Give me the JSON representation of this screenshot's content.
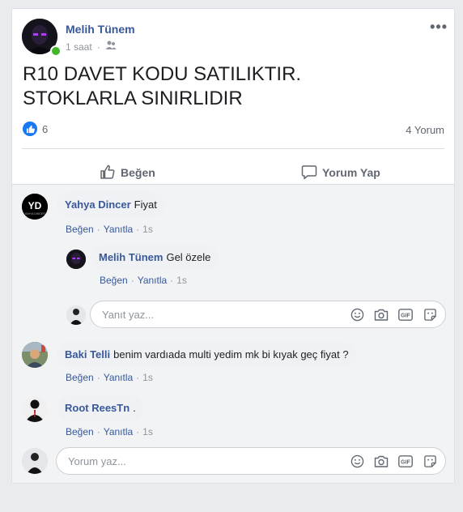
{
  "post": {
    "author": "Melih Tünem",
    "time": "1 saat",
    "text_line1": "R10 DAVET KODU SATILIKTIR.",
    "text_line2": "STOKLARLA SINIRLIDIR",
    "like_count": "6",
    "comments_count": "4 Yorum",
    "more": "•••"
  },
  "actions": {
    "like_label": "Beğen",
    "comment_label": "Yorum Yap"
  },
  "comments": [
    {
      "name": "Yahya Dincer",
      "text": "Fiyat",
      "like": "Beğen",
      "reply": "Yanıtla",
      "time": "1s"
    },
    {
      "name": "Baki Telli",
      "text": "benim vardıada multi yedim mk bi kıyak geç fiyat ?",
      "like": "Beğen",
      "reply": "Yanıtla",
      "time": "1s"
    },
    {
      "name": "Root ReesTn",
      "text": ".",
      "like": "Beğen",
      "reply": "Yanıtla",
      "time": "1s"
    }
  ],
  "reply": {
    "name": "Melih Tünem",
    "text": "Gel özele",
    "like": "Beğen",
    "reply": "Yanıtla",
    "time": "1s"
  },
  "reply_input": {
    "placeholder": "Yanıt yaz..."
  },
  "comment_input": {
    "placeholder": "Yorum yaz..."
  },
  "colors": {
    "accent": "#385898",
    "like_blue": "#1877f2",
    "online": "#42b72a"
  }
}
